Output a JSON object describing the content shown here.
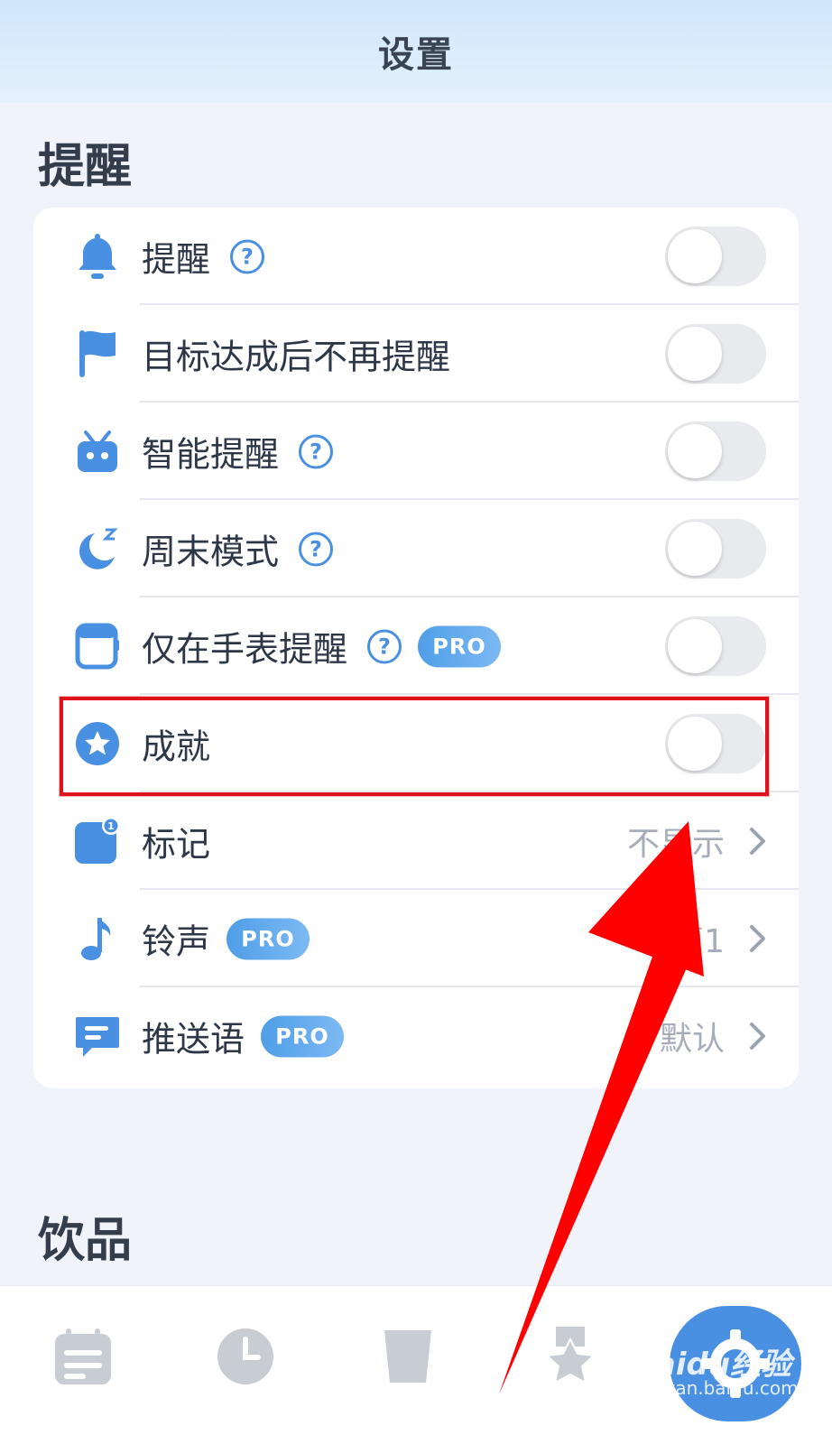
{
  "header": {
    "title": "设置"
  },
  "reminder_section": {
    "title": "提醒",
    "rows": [
      {
        "label": "提醒",
        "help": "?",
        "icon": "bell-icon",
        "toggle": false
      },
      {
        "label": "目标达成后不再提醒",
        "icon": "flag-icon",
        "toggle": false
      },
      {
        "label": "智能提醒",
        "help": "?",
        "icon": "robot-icon",
        "toggle": false
      },
      {
        "label": "周末模式",
        "help": "?",
        "icon": "moon-sleep-icon",
        "toggle": false
      },
      {
        "label": "仅在手表提醒",
        "help": "?",
        "pro": "PRO",
        "icon": "watch-icon",
        "toggle": false
      },
      {
        "label": "成就",
        "icon": "star-badge-icon",
        "toggle": false
      },
      {
        "label": "标记",
        "value": "不显示",
        "icon": "badge-note-icon",
        "badge_count": "1"
      },
      {
        "label": "铃声",
        "pro": "PRO",
        "value": "水滴1",
        "icon": "music-note-icon"
      },
      {
        "label": "推送语",
        "pro": "PRO",
        "value": "默认",
        "icon": "message-icon"
      }
    ]
  },
  "drinks_section": {
    "title": "饮品"
  },
  "tabbar": {
    "tabs": [
      {
        "name": "tab-records",
        "icon": "notes-icon"
      },
      {
        "name": "tab-history",
        "icon": "clock-icon"
      },
      {
        "name": "tab-cup",
        "icon": "cup-icon"
      },
      {
        "name": "tab-achievements",
        "icon": "star-icon"
      },
      {
        "name": "tab-settings",
        "icon": "gear-icon",
        "active": true
      }
    ]
  },
  "watermark": {
    "line1": "Baidu经验",
    "line2": "jingyan.baidu.com"
  },
  "colors": {
    "accent": "#4a90e2",
    "highlight": "#e0121b",
    "arrow": "#ff0000"
  }
}
